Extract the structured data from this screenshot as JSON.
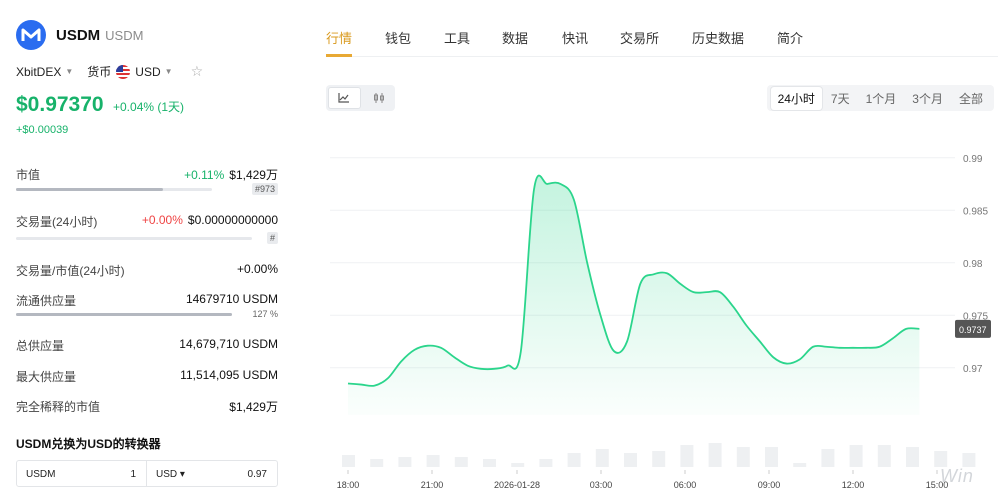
{
  "coin": {
    "name": "USDM",
    "symbol": "USDM",
    "exchange": "XbitDEX",
    "currency_label": "货币",
    "currency": "USD",
    "price": "$0.97370",
    "change_pct": "+0.04% (1天)",
    "change_abs": "+$0.00039",
    "accent_color": "#17b26a"
  },
  "stats": {
    "market_cap": {
      "label": "市值",
      "change": "+0.11%",
      "value": "$1,429万",
      "rank": "#973",
      "bar_fraction": 0.75
    },
    "volume": {
      "label": "交易量(24小时)",
      "change": "+0.00%",
      "value": "$0.00000000000",
      "rank": "#",
      "bar_fraction": 0.0
    },
    "vol_mcap": {
      "label": "交易量/市值(24小时)",
      "value": "+0.00%"
    },
    "circulating": {
      "label": "流通供应量",
      "value": "14679710 USDM",
      "pct": "127 %",
      "bar_fraction": 1.0
    },
    "total": {
      "label": "总供应量",
      "value": "14,679,710 USDM"
    },
    "max": {
      "label": "最大供应量",
      "value": "11,514,095 USDM"
    },
    "fdv": {
      "label": "完全稀释的市值",
      "value": "$1,429万"
    }
  },
  "converter": {
    "title": "USDM兑换为USD的转换器",
    "from_symbol": "USDM",
    "from_amount": "1",
    "to_symbol": "USD ▾",
    "to_amount": "0.97"
  },
  "tabs": [
    "行情",
    "钱包",
    "工具",
    "数据",
    "快讯",
    "交易所",
    "历史数据",
    "简介"
  ],
  "active_tab": "行情",
  "chart_types": {
    "line_icon": "line-chart-icon",
    "candle_icon": "candlestick-icon"
  },
  "ranges": [
    "24小时",
    "7天",
    "1个月",
    "3个月",
    "全部"
  ],
  "active_range": "24小时",
  "watermark": "Win",
  "chart_data": {
    "type": "area",
    "x_ticks": [
      "18:00",
      "21:00",
      "2026-01-28",
      "03:00",
      "06:00",
      "09:00",
      "12:00",
      "15:00"
    ],
    "y_ticks": [
      "0.99",
      "0.985",
      "0.98",
      "0.975",
      "0.97"
    ],
    "ylim": [
      0.9655,
      0.9915
    ],
    "current_label": "0.9737",
    "line_color": "#2bd58c",
    "x_hours": [
      0,
      0.5,
      1,
      1.5,
      2,
      2.5,
      3,
      3.5,
      4,
      4.5,
      5,
      5.5,
      6,
      6.5,
      7,
      7.5,
      8,
      8.5,
      9,
      9.5,
      10,
      10.5,
      11,
      11.5,
      12,
      12.5,
      13,
      13.5,
      14,
      14.5,
      15,
      15.5,
      16,
      16.5,
      17,
      17.5,
      18,
      18.5,
      19,
      19.5,
      20,
      20.5,
      21,
      21.5
    ],
    "values": [
      0.9685,
      0.9684,
      0.9683,
      0.969,
      0.9706,
      0.9717,
      0.9721,
      0.9719,
      0.971,
      0.9702,
      0.9699,
      0.9699,
      0.9702,
      0.9715,
      0.987,
      0.9875,
      0.9875,
      0.986,
      0.98,
      0.975,
      0.9716,
      0.9725,
      0.978,
      0.9789,
      0.979,
      0.978,
      0.9772,
      0.9772,
      0.9772,
      0.9758,
      0.974,
      0.9725,
      0.971,
      0.9704,
      0.9708,
      0.972,
      0.972,
      0.9719,
      0.9719,
      0.9719,
      0.972,
      0.9728,
      0.9737,
      0.9737
    ],
    "volume": [
      0.3,
      0.2,
      0.25,
      0.3,
      0.25,
      0.2,
      0.1,
      0.2,
      0.35,
      0.45,
      0.35,
      0.4,
      0.55,
      0.6,
      0.5,
      0.5,
      0.1,
      0.45,
      0.55,
      0.55,
      0.5,
      0.4,
      0.35
    ]
  }
}
